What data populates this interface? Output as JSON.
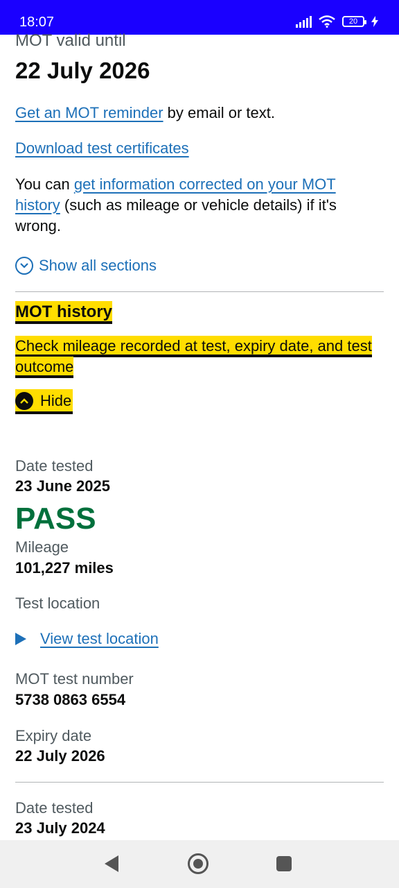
{
  "status_bar": {
    "time": "18:07",
    "battery": "20",
    "icons": [
      "signal-icon",
      "wifi-icon",
      "battery-icon",
      "charging-icon"
    ]
  },
  "summary": {
    "mot_valid_label": "MOT valid until",
    "mot_valid_date": "22 July 2026",
    "reminder_link": "Get an MOT reminder",
    "reminder_suffix": " by email or text.",
    "download_link": "Download test certificates",
    "correct_prefix": "You can ",
    "correct_link": "get information corrected on your MOT history",
    "correct_suffix": " (such as mileage or vehicle details) if it's wrong.",
    "show_all": "Show all sections"
  },
  "mot_history": {
    "title": "MOT history",
    "description": "Check mileage recorded at test, expiry date, and test outcome",
    "toggle": "Hide",
    "tests": [
      {
        "date_label": "Date tested",
        "date": "23 June 2025",
        "result": "PASS",
        "mileage_label": "Mileage",
        "mileage": "101,227 miles",
        "location_label": "Test location",
        "location_link": "View test location",
        "number_label": "MOT test number",
        "number": "5738 0863 6554",
        "expiry_label": "Expiry date",
        "expiry": "22 July 2026"
      },
      {
        "date_label": "Date tested",
        "date": "23 July 2024"
      }
    ]
  },
  "colors": {
    "status_bar": "#1a00ff",
    "link": "#1d70b8",
    "pass": "#00703c",
    "focus_highlight": "#ffdd00"
  }
}
